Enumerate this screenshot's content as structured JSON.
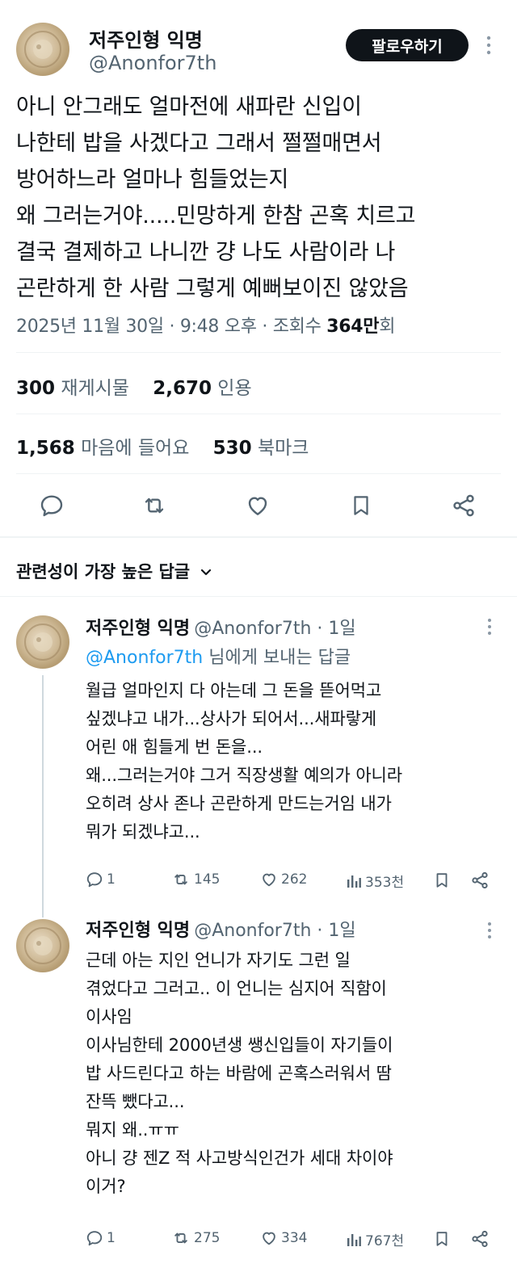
{
  "tweet": {
    "author_name": "저주인형 익명",
    "author_handle": "@Anonfor7th",
    "follow_label": "팔로우하기",
    "text": "아니 안그래도 얼마전에 새파란 신입이\n나한테 밥을 사겠다고 그래서 쩔쩔매면서\n방어하느라 얼마나 힘들었는지\n왜 그러는거야.....민망하게 한참 곤혹 치르고\n결국 결제하고 나니깐 걍 나도 사람이라 나\n곤란하게 한 사람 그렇게 예뻐보이진 않았음",
    "timestamp": "2025년 11월 30일 · 9:48 오후 · 조회수",
    "views_number": "364만",
    "views_suffix": "회",
    "retweets_count": "300",
    "retweets_label": "재게시물",
    "quotes_count": "2,670",
    "quotes_label": "인용",
    "likes_count": "1,568",
    "likes_label": "마음에 들어요",
    "bookmarks_count": "530",
    "bookmarks_label": "북마크"
  },
  "replies_header": {
    "label": "관련성이 가장 높은 답글"
  },
  "replies": [
    {
      "name": "저주인형 익명",
      "handle_time": "@Anonfor7th · 1일",
      "replying_mention": "@Anonfor7th",
      "replying_suffix": "님에게 보내는 답글",
      "text": "월급 얼마인지 다 아는데 그 돈을 뜯어먹고\n싶겠냐고 내가...상사가 되어서...새파랗게\n어린 애 힘들게 번 돈을...\n왜...그러는거야 그거 직장생활 예의가 아니라\n오히려 상사 존나 곤란하게 만드는거임 내가\n뭐가 되겠냐고...",
      "reply_count": "1",
      "retweet_count": "145",
      "like_count": "262",
      "view_count": "353천"
    },
    {
      "name": "저주인형 익명",
      "handle_time": "@Anonfor7th · 1일",
      "text": "근데 아는 지인 언니가 자기도 그런 일\n겪었다고 그러고.. 이 언니는 심지어 직함이\n이사임\n이사님한테 2000년생 쌩신입들이 자기들이\n밥 사드린다고 하는 바람에 곤혹스러워서 땀\n잔뜩 뺐다고...\n뭐지 왜..ㅠㅠ\n아니 걍 젠Z 적 사고방식인건가 세대 차이야\n이거?",
      "reply_count": "1",
      "retweet_count": "275",
      "like_count": "334",
      "view_count": "767천"
    }
  ],
  "colors": {
    "text": "#0f1419",
    "muted": "#536471",
    "link": "#1d9bf0",
    "divider": "#eff3f4",
    "button": "#0f1419"
  },
  "icons": [
    "reply-icon",
    "retweet-icon",
    "heart-icon",
    "bookmark-icon",
    "share-icon",
    "views-icon",
    "chevron-down-icon",
    "more-icon"
  ]
}
